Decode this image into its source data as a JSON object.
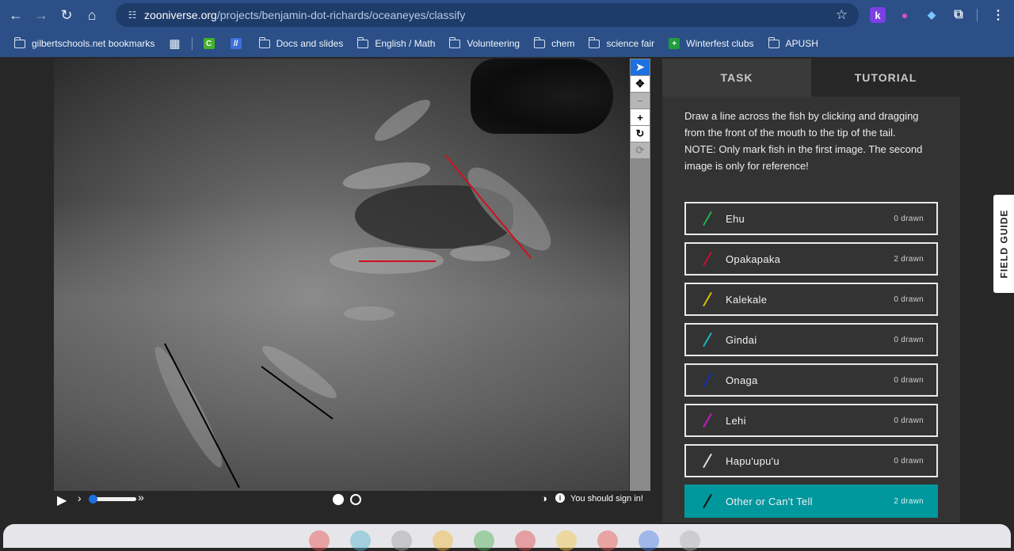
{
  "browser": {
    "url_host": "zooniverse.org",
    "url_path": "/projects/benjamin-dot-richards/oceaneyes/classify",
    "nav_icons": [
      "back-arrow-icon",
      "forward-arrow-icon",
      "reload-icon",
      "home-icon"
    ],
    "extensions": [
      "k",
      "●",
      "◆",
      "⧉",
      "⋮"
    ]
  },
  "bookmarks": [
    {
      "label": "gilbertschools.net bookmarks",
      "icon": "folder-managed-icon"
    },
    {
      "label": "Docs and slides",
      "icon": "folder-icon"
    },
    {
      "label": "English / Math",
      "icon": "folder-icon"
    },
    {
      "label": "Volunteering",
      "icon": "folder-icon"
    },
    {
      "label": "chem",
      "icon": "folder-icon"
    },
    {
      "label": "science fair",
      "icon": "folder-icon"
    },
    {
      "label": "Winterfest clubs",
      "icon": "green-plus-icon"
    },
    {
      "label": "APUSH",
      "icon": "folder-icon"
    }
  ],
  "panel": {
    "tabs": {
      "task": "TASK",
      "tutorial": "TUTORIAL"
    },
    "instructions": "Draw a line across the fish by clicking and dragging from the front of the mouth to the tip of the tail.",
    "note": "NOTE: Only mark fish in the first image. The second image is only for reference!",
    "choices": [
      {
        "name": "Ehu",
        "count": "0 drawn",
        "color": "#22b14c"
      },
      {
        "name": "Opakapaka",
        "count": "2 drawn",
        "color": "#c8102e"
      },
      {
        "name": "Kalekale",
        "count": "0 drawn",
        "color": "#d4c400"
      },
      {
        "name": "Gindai",
        "count": "0 drawn",
        "color": "#1bb4c4"
      },
      {
        "name": "Onaga",
        "count": "0 drawn",
        "color": "#1a2fb8"
      },
      {
        "name": "Lehi",
        "count": "0 drawn",
        "color": "#c21ec2"
      },
      {
        "name": "Hapu'upu'u",
        "count": "0 drawn",
        "color": "#e0e0e0"
      },
      {
        "name": "Other or Can't Tell",
        "count": "2 drawn",
        "color": "#111111"
      }
    ]
  },
  "viewer": {
    "sign_in": "You should sign in!",
    "tools": [
      "pointer-icon",
      "move-icon",
      "zoom-out-icon",
      "zoom-in-icon",
      "rotate-icon",
      "reset-icon"
    ]
  },
  "field_guide": "FIELD GUIDE"
}
